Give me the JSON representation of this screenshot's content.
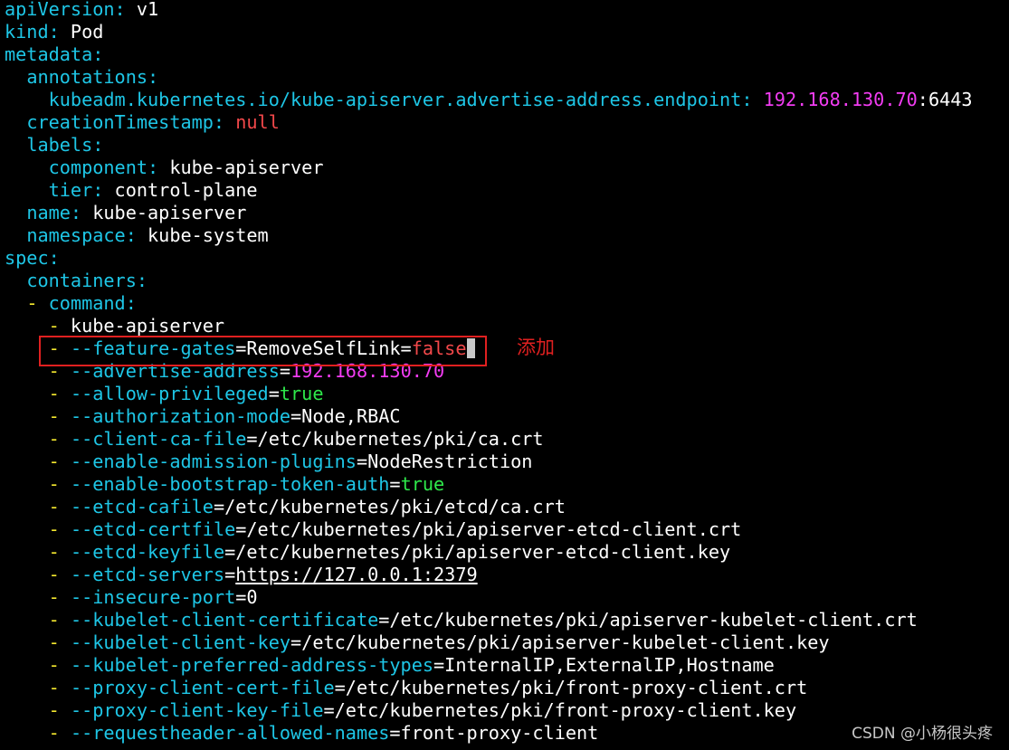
{
  "lines": [
    [
      [
        "k",
        "apiVersion:"
      ],
      [
        "w",
        " v1"
      ]
    ],
    [
      [
        "k",
        "kind:"
      ],
      [
        "w",
        " Pod"
      ]
    ],
    [
      [
        "k",
        "metadata:"
      ]
    ],
    [
      [
        "w",
        "  "
      ],
      [
        "k",
        "annotations:"
      ]
    ],
    [
      [
        "w",
        "    "
      ],
      [
        "k",
        "kubeadm.kubernetes.io/kube-apiserver.advertise-address.endpoint:"
      ],
      [
        "w",
        " "
      ],
      [
        "m",
        "192.168.130.70"
      ],
      [
        "w",
        ":6443"
      ]
    ],
    [
      [
        "w",
        "  "
      ],
      [
        "k",
        "creationTimestamp:"
      ],
      [
        "w",
        " "
      ],
      [
        "r",
        "null"
      ]
    ],
    [
      [
        "w",
        "  "
      ],
      [
        "k",
        "labels:"
      ]
    ],
    [
      [
        "w",
        "    "
      ],
      [
        "k",
        "component:"
      ],
      [
        "w",
        " kube-apiserver"
      ]
    ],
    [
      [
        "w",
        "    "
      ],
      [
        "k",
        "tier:"
      ],
      [
        "w",
        " control-plane"
      ]
    ],
    [
      [
        "w",
        "  "
      ],
      [
        "k",
        "name:"
      ],
      [
        "w",
        " kube-apiserver"
      ]
    ],
    [
      [
        "w",
        "  "
      ],
      [
        "k",
        "namespace:"
      ],
      [
        "w",
        " kube-system"
      ]
    ],
    [
      [
        "k",
        "spec:"
      ]
    ],
    [
      [
        "w",
        "  "
      ],
      [
        "k",
        "containers:"
      ]
    ],
    [
      [
        "w",
        "  "
      ],
      [
        "y",
        "-"
      ],
      [
        "w",
        " "
      ],
      [
        "k",
        "command:"
      ]
    ],
    [
      [
        "w",
        "    "
      ],
      [
        "y",
        "-"
      ],
      [
        "w",
        " kube-apiserver"
      ]
    ],
    [
      [
        "w",
        "    "
      ],
      [
        "y",
        "-"
      ],
      [
        "w",
        " "
      ],
      [
        "k",
        "--feature-gates"
      ],
      [
        "w",
        "=RemoveSelfLink="
      ],
      [
        "r",
        "false"
      ]
    ],
    [
      [
        "w",
        "    "
      ],
      [
        "y",
        "-"
      ],
      [
        "w",
        " "
      ],
      [
        "k",
        "--advertise-address"
      ],
      [
        "w",
        "="
      ],
      [
        "m",
        "192.168.130.70"
      ]
    ],
    [
      [
        "w",
        "    "
      ],
      [
        "y",
        "-"
      ],
      [
        "w",
        " "
      ],
      [
        "k",
        "--allow-privileged"
      ],
      [
        "w",
        "="
      ],
      [
        "g",
        "true"
      ]
    ],
    [
      [
        "w",
        "    "
      ],
      [
        "y",
        "-"
      ],
      [
        "w",
        " "
      ],
      [
        "k",
        "--authorization-mode"
      ],
      [
        "w",
        "=Node,RBAC"
      ]
    ],
    [
      [
        "w",
        "    "
      ],
      [
        "y",
        "-"
      ],
      [
        "w",
        " "
      ],
      [
        "k",
        "--client-ca-file"
      ],
      [
        "w",
        "=/etc/kubernetes/pki/ca.crt"
      ]
    ],
    [
      [
        "w",
        "    "
      ],
      [
        "y",
        "-"
      ],
      [
        "w",
        " "
      ],
      [
        "k",
        "--enable-admission-plugins"
      ],
      [
        "w",
        "=NodeRestriction"
      ]
    ],
    [
      [
        "w",
        "    "
      ],
      [
        "y",
        "-"
      ],
      [
        "w",
        " "
      ],
      [
        "k",
        "--enable-bootstrap-token-auth"
      ],
      [
        "w",
        "="
      ],
      [
        "g",
        "true"
      ]
    ],
    [
      [
        "w",
        "    "
      ],
      [
        "y",
        "-"
      ],
      [
        "w",
        " "
      ],
      [
        "k",
        "--etcd-cafile"
      ],
      [
        "w",
        "=/etc/kubernetes/pki/etcd/ca.crt"
      ]
    ],
    [
      [
        "w",
        "    "
      ],
      [
        "y",
        "-"
      ],
      [
        "w",
        " "
      ],
      [
        "k",
        "--etcd-certfile"
      ],
      [
        "w",
        "=/etc/kubernetes/pki/apiserver-etcd-client.crt"
      ]
    ],
    [
      [
        "w",
        "    "
      ],
      [
        "y",
        "-"
      ],
      [
        "w",
        " "
      ],
      [
        "k",
        "--etcd-keyfile"
      ],
      [
        "w",
        "=/etc/kubernetes/pki/apiserver-etcd-client.key"
      ]
    ],
    [
      [
        "w",
        "    "
      ],
      [
        "y",
        "-"
      ],
      [
        "w",
        " "
      ],
      [
        "k",
        "--etcd-servers"
      ],
      [
        "w",
        "="
      ],
      [
        "u",
        "https://127.0.0.1:2379"
      ]
    ],
    [
      [
        "w",
        "    "
      ],
      [
        "y",
        "-"
      ],
      [
        "w",
        " "
      ],
      [
        "k",
        "--insecure-port"
      ],
      [
        "w",
        "=0"
      ]
    ],
    [
      [
        "w",
        "    "
      ],
      [
        "y",
        "-"
      ],
      [
        "w",
        " "
      ],
      [
        "k",
        "--kubelet-client-certificate"
      ],
      [
        "w",
        "=/etc/kubernetes/pki/apiserver-kubelet-client.crt"
      ]
    ],
    [
      [
        "w",
        "    "
      ],
      [
        "y",
        "-"
      ],
      [
        "w",
        " "
      ],
      [
        "k",
        "--kubelet-client-key"
      ],
      [
        "w",
        "=/etc/kubernetes/pki/apiserver-kubelet-client.key"
      ]
    ],
    [
      [
        "w",
        "    "
      ],
      [
        "y",
        "-"
      ],
      [
        "w",
        " "
      ],
      [
        "k",
        "--kubelet-preferred-address-types"
      ],
      [
        "w",
        "=InternalIP,ExternalIP,Hostname"
      ]
    ],
    [
      [
        "w",
        "    "
      ],
      [
        "y",
        "-"
      ],
      [
        "w",
        " "
      ],
      [
        "k",
        "--proxy-client-cert-file"
      ],
      [
        "w",
        "=/etc/kubernetes/pki/front-proxy-client.crt"
      ]
    ],
    [
      [
        "w",
        "    "
      ],
      [
        "y",
        "-"
      ],
      [
        "w",
        " "
      ],
      [
        "k",
        "--proxy-client-key-file"
      ],
      [
        "w",
        "=/etc/kubernetes/pki/front-proxy-client.key"
      ]
    ],
    [
      [
        "w",
        "    "
      ],
      [
        "y",
        "-"
      ],
      [
        "w",
        " "
      ],
      [
        "k",
        "--requestheader-allowed-names"
      ],
      [
        "w",
        "=front-proxy-client"
      ]
    ]
  ],
  "cursor_line": 15,
  "annotation": "添加",
  "watermark": "CSDN @小杨很头疼",
  "colors": {
    "background": "#000000",
    "key": "#1ec6e6",
    "number": "#f23cf2",
    "false_null": "#f2484a",
    "true": "#2ee84a",
    "dash": "#f2e62e",
    "annotation": "#e02020"
  }
}
